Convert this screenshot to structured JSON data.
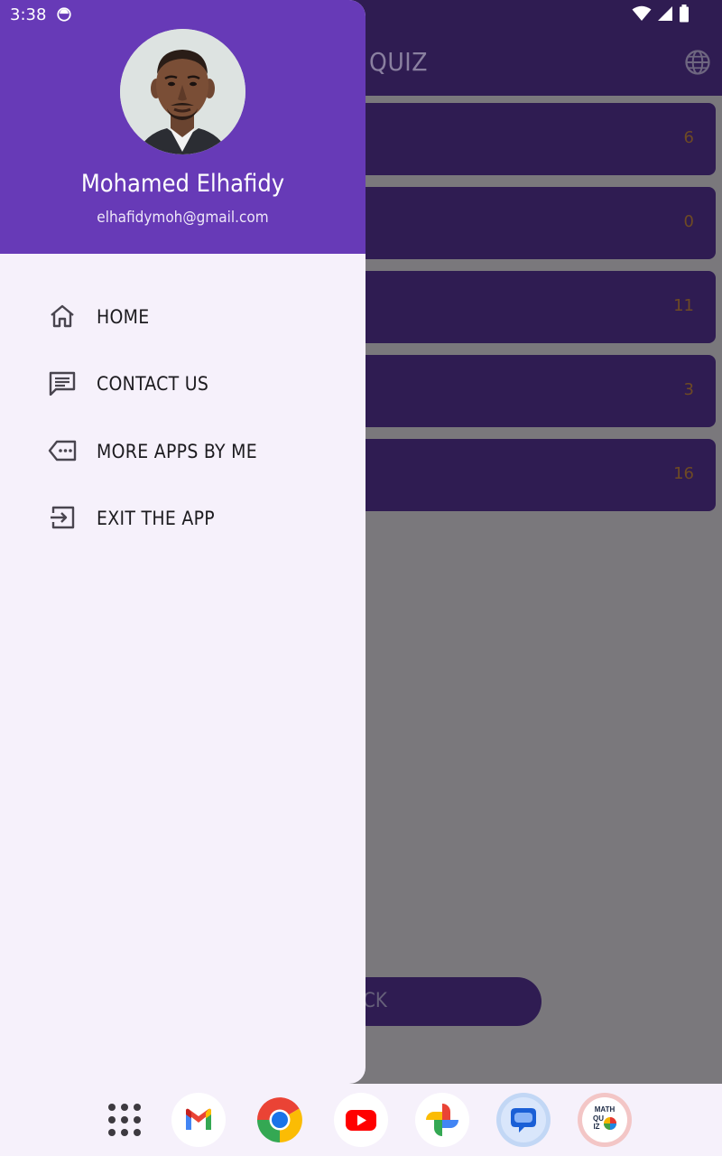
{
  "status_bar": {
    "time": "3:38"
  },
  "background_app": {
    "title": "QUIZ",
    "categories": [
      {
        "count": "6"
      },
      {
        "count": "0"
      },
      {
        "count": "11"
      },
      {
        "count": "3"
      },
      {
        "count": "16"
      }
    ],
    "bottom_button_label": "CK"
  },
  "drawer": {
    "user_name": "Mohamed Elhafidy",
    "user_email": "elhafidymoh@gmail.com",
    "items": [
      {
        "label": "HOME",
        "icon": "home-icon"
      },
      {
        "label": "CONTACT US",
        "icon": "message-icon"
      },
      {
        "label": "MORE APPS BY ME",
        "icon": "more-label-icon"
      },
      {
        "label": "EXIT THE APP",
        "icon": "exit-icon"
      }
    ]
  },
  "dock": {
    "apps": [
      {
        "name": "app-drawer"
      },
      {
        "name": "gmail"
      },
      {
        "name": "chrome"
      },
      {
        "name": "youtube"
      },
      {
        "name": "photos"
      },
      {
        "name": "messages"
      },
      {
        "name": "math-quiz",
        "label": "MATH QUIZ"
      }
    ]
  },
  "colors": {
    "drawer_header": "#673ab7",
    "drawer_bg": "#f6f1fb",
    "app_bar": "#2f1c52",
    "scrim": "#7a787c"
  }
}
